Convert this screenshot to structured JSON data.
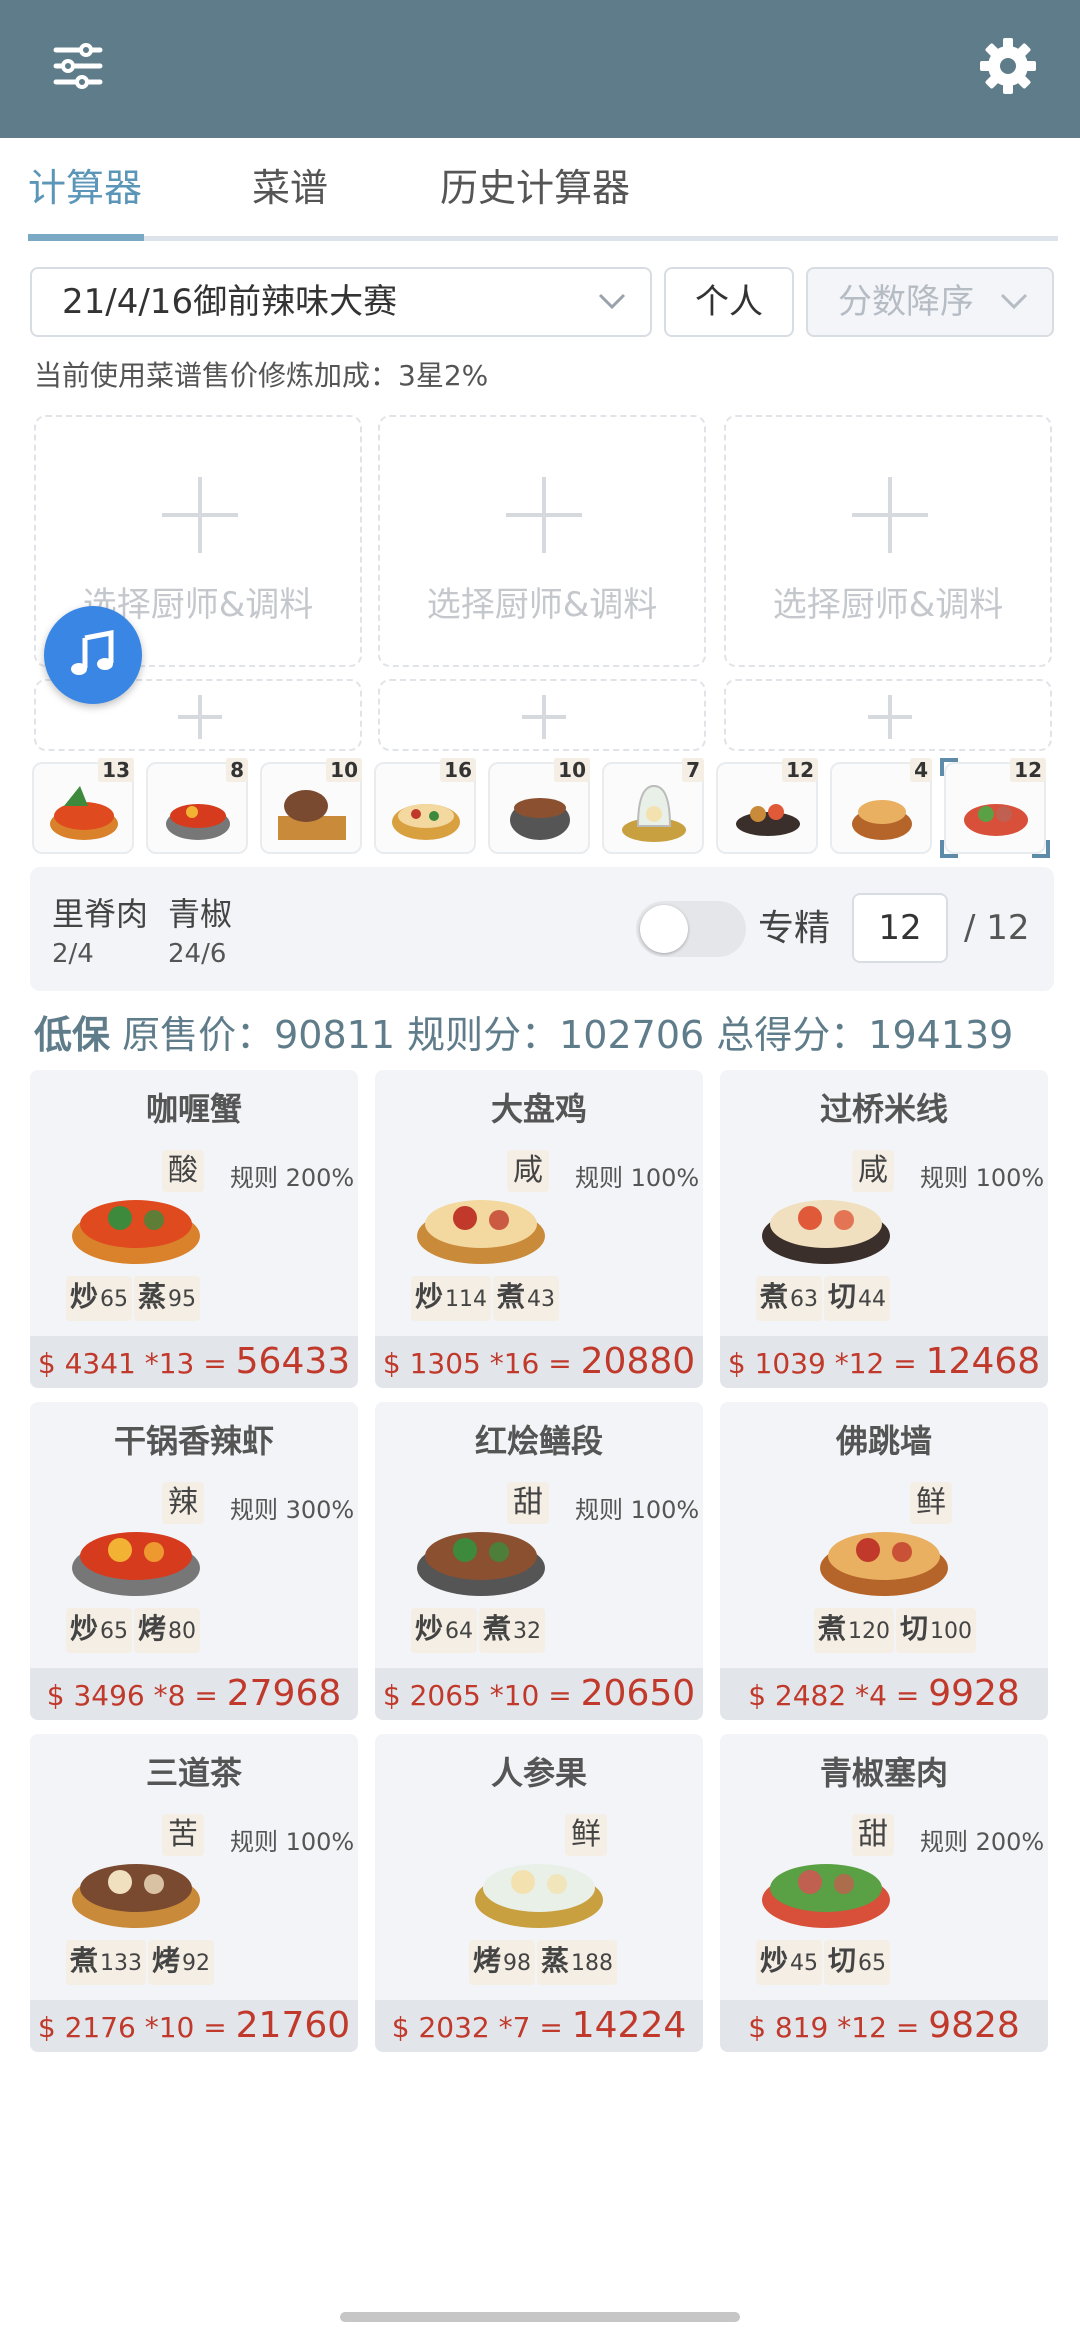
{
  "toolbar": {
    "menu_icon": "sliders-icon",
    "settings_icon": "gear-icon"
  },
  "tabs": [
    {
      "label": "计算器",
      "active": true
    },
    {
      "label": "菜谱"
    },
    {
      "label": "历史计算器"
    }
  ],
  "filters": {
    "contest": "21/4/16御前辣味大赛",
    "mode": "个人",
    "sort": "分数降序"
  },
  "bonus_text": "当前使用菜谱售价修炼加成：3星2%",
  "chef_slots": [
    {
      "label": "选择厨师&调料"
    },
    {
      "label": "选择厨师&调料"
    },
    {
      "label": "选择厨师&调料"
    }
  ],
  "thumbnails": [
    {
      "count": "13"
    },
    {
      "count": "8"
    },
    {
      "count": "10"
    },
    {
      "count": "16"
    },
    {
      "count": "10"
    },
    {
      "count": "7"
    },
    {
      "count": "12"
    },
    {
      "count": "4"
    },
    {
      "count": "12",
      "selected": true
    }
  ],
  "detail": {
    "ingredients": [
      {
        "name": "里脊肉",
        "qty": "2/4"
      },
      {
        "name": "青椒",
        "qty": "24/6"
      }
    ],
    "mastery_label": "专精",
    "quantity": "12",
    "quantity_total": "/ 12"
  },
  "summary": {
    "label": "低保",
    "orig_label": "原售价：",
    "orig_value": "90811",
    "rule_label": "规则分：",
    "rule_value": "102706",
    "total_label": "总得分：",
    "total_value": "194139"
  },
  "dishes": [
    {
      "name": "咖喱蟹",
      "flavor": "酸",
      "rule": "规则 200%",
      "skills": [
        {
          "k": "炒",
          "v": "65"
        },
        {
          "k": "蒸",
          "v": "95"
        }
      ],
      "price": "4341",
      "mult": "*13",
      "total": "56433"
    },
    {
      "name": "大盘鸡",
      "flavor": "咸",
      "rule": "规则 100%",
      "skills": [
        {
          "k": "炒",
          "v": "114"
        },
        {
          "k": "煮",
          "v": "43"
        }
      ],
      "price": "1305",
      "mult": "*16",
      "total": "20880"
    },
    {
      "name": "过桥米线",
      "flavor": "咸",
      "rule": "规则 100%",
      "skills": [
        {
          "k": "煮",
          "v": "63"
        },
        {
          "k": "切",
          "v": "44"
        }
      ],
      "price": "1039",
      "mult": "*12",
      "total": "12468"
    },
    {
      "name": "干锅香辣虾",
      "flavor": "辣",
      "rule": "规则 300%",
      "skills": [
        {
          "k": "炒",
          "v": "65"
        },
        {
          "k": "烤",
          "v": "80"
        }
      ],
      "price": "3496",
      "mult": "*8",
      "total": "27968"
    },
    {
      "name": "红烩鳝段",
      "flavor": "甜",
      "rule": "规则 100%",
      "skills": [
        {
          "k": "炒",
          "v": "64"
        },
        {
          "k": "煮",
          "v": "32"
        }
      ],
      "price": "2065",
      "mult": "*10",
      "total": "20650"
    },
    {
      "name": "佛跳墙",
      "flavor": "鲜",
      "rule": "",
      "skills": [
        {
          "k": "煮",
          "v": "120"
        },
        {
          "k": "切",
          "v": "100"
        }
      ],
      "price": "2482",
      "mult": "*4",
      "total": "9928"
    },
    {
      "name": "三道茶",
      "flavor": "苦",
      "rule": "规则 100%",
      "skills": [
        {
          "k": "煮",
          "v": "133"
        },
        {
          "k": "烤",
          "v": "92"
        }
      ],
      "price": "2176",
      "mult": "*10",
      "total": "21760"
    },
    {
      "name": "人参果",
      "flavor": "鲜",
      "rule": "",
      "skills": [
        {
          "k": "烤",
          "v": "98"
        },
        {
          "k": "蒸",
          "v": "188"
        }
      ],
      "price": "2032",
      "mult": "*7",
      "total": "14224"
    },
    {
      "name": "青椒塞肉",
      "flavor": "甜",
      "rule": "规则 200%",
      "skills": [
        {
          "k": "炒",
          "v": "45"
        },
        {
          "k": "切",
          "v": "65"
        }
      ],
      "price": "819",
      "mult": "*12",
      "total": "9828"
    }
  ],
  "colors": {
    "header": "#5f7c8a",
    "accent": "#5b96b8",
    "price": "#c0392b",
    "fab": "#3a86e4"
  }
}
